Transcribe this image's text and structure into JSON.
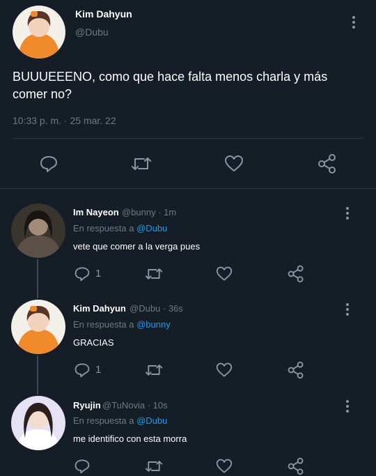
{
  "main_tweet": {
    "author_name": "Kim Dahyun",
    "author_handle": "@Dubu",
    "text": "BUUUEEENO, como que hace falta menos charla y más comer no?",
    "timestamp": "10:33 p. m. · 25 mar. 22"
  },
  "replies": [
    {
      "author_name": "Im Nayeon",
      "meta": "@bunny · 1m",
      "reply_prefix": "En respuesta a",
      "reply_to": "@Dubu",
      "text": "vete que comer a la verga pues",
      "reply_count": "1"
    },
    {
      "author_name": "Kim Dahyun",
      "meta": "@Dubu · 36s",
      "reply_prefix": "En respuesta a",
      "reply_to": "@bunny",
      "text": "GRACIAS",
      "reply_count": "1"
    },
    {
      "author_name": "Ryujin",
      "meta": "@TuNovia · 10s",
      "reply_prefix": "En respuesta a",
      "reply_to": "@Dubu",
      "text": "me identifico con esta morra",
      "reply_count": ""
    }
  ],
  "icons": [
    "reply-icon",
    "retweet-icon",
    "like-icon",
    "share-icon",
    "more-options-icon"
  ],
  "colors": {
    "background": "#151d26",
    "accent": "#1d9bf0",
    "muted": "#6d7a86"
  }
}
